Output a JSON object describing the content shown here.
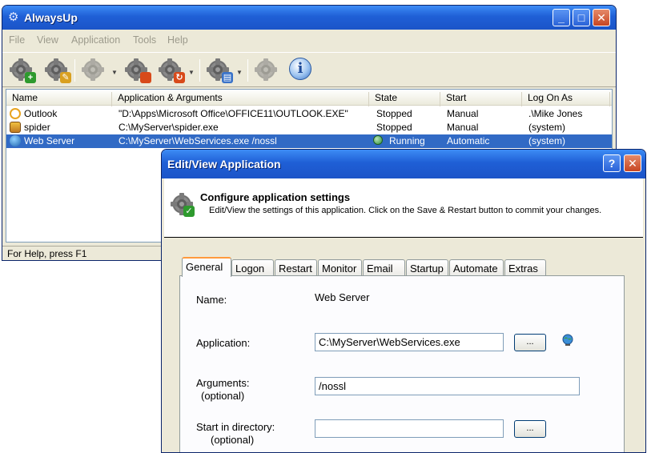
{
  "main": {
    "title": "AlwaysUp",
    "menu": [
      "File",
      "View",
      "Application",
      "Tools",
      "Help"
    ],
    "columns": [
      "Name",
      "Application & Arguments",
      "State",
      "Start",
      "Log On As"
    ],
    "rows": [
      {
        "name": "Outlook",
        "app": "\"D:\\Apps\\Microsoft Office\\OFFICE11\\OUTLOOK.EXE\"",
        "state": "Stopped",
        "start": "Manual",
        "logon": ".\\Mike Jones"
      },
      {
        "name": "spider",
        "app": "C:\\MyServer\\spider.exe",
        "state": "Stopped",
        "start": "Manual",
        "logon": "(system)"
      },
      {
        "name": "Web Server",
        "app": "C:\\MyServer\\WebServices.exe /nossl",
        "state": "Running",
        "start": "Automatic",
        "logon": "(system)"
      }
    ],
    "status": "For Help, press F1"
  },
  "dialog": {
    "title": "Edit/View Application",
    "heading": "Configure application settings",
    "subheading": "Edit/View the settings of this application. Click on the Save & Restart button to commit your changes.",
    "tabs": [
      "General",
      "Logon",
      "Restart",
      "Monitor",
      "Email",
      "Startup",
      "Automate",
      "Extras"
    ],
    "name_label": "Name:",
    "name_value": "Web Server",
    "application_label": "Application:",
    "application_value": "C:\\MyServer\\WebServices.exe",
    "arguments_label": "Arguments:",
    "arguments_optional": "(optional)",
    "arguments_value": "/nossl",
    "startdir_label": "Start in directory:",
    "startdir_optional": "(optional)",
    "startdir_value": "",
    "browse_label": "..."
  },
  "colors": {
    "selection": "#316ac5",
    "titlebar": "#1f5fd6",
    "running": "#2f8f3a"
  }
}
